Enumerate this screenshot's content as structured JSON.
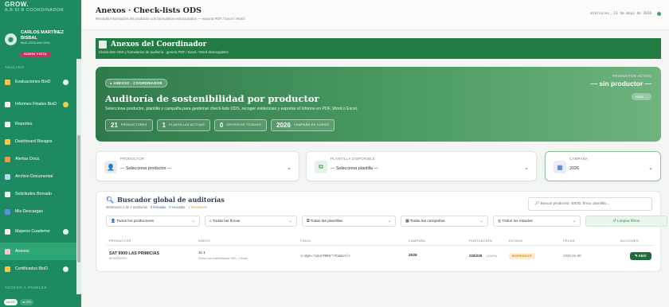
{
  "sidebar": {
    "top_text": "A.B  SI.B  COORDINADOR",
    "logo": "GROW.",
    "user": {
      "avatar": "◉",
      "name": "CARLOS MARTÍNEZ BISBAL",
      "id": "BioD-2025-###-0001",
      "badge": "ADMIN VISTA"
    },
    "section_label": "ANÁLISIS",
    "items": [
      {
        "label": "Evaluaciones BioD",
        "icon": "shield-icon",
        "color": "#f2c94c",
        "dot": "white",
        "tall": true
      },
      {
        "label": "Informes Finales BioD",
        "icon": "document-icon",
        "color": "#f1f1f1",
        "dot": "yellow",
        "tall": true
      },
      {
        "label": "Reportes",
        "icon": "chart-icon",
        "color": "#f1f1f1",
        "dot": "",
        "tall": false
      },
      {
        "label": "Dashboard Riesgos",
        "icon": "warning-icon",
        "color": "#f2c94c",
        "dot": "",
        "tall": false
      },
      {
        "label": "Alertas Docs.",
        "icon": "alert-icon",
        "color": "#f2994a",
        "dot": "",
        "tall": false
      },
      {
        "label": "Archivo Documental",
        "icon": "archive-icon",
        "color": "#b9d7f0",
        "dot": "",
        "tall": false
      },
      {
        "label": "Solicitudes Borrado",
        "icon": "mail-icon",
        "color": "#f1f1f1",
        "dot": "",
        "tall": false
      },
      {
        "label": "Mis Descargas",
        "icon": "download-icon",
        "color": "#5b8def",
        "dot": "",
        "tall": false
      },
      {
        "label": "Mapeos Cuaderno",
        "icon": "map-icon",
        "color": "#f1f1f1",
        "dot": "white",
        "tall": true
      },
      {
        "label": "Anexos",
        "icon": "clip-icon",
        "color": "#f7c6d9",
        "dot": "",
        "tall": false,
        "active": true
      },
      {
        "label": "Certificados BioD",
        "icon": "certificate-icon",
        "color": "#f2c94c",
        "dot": "white",
        "tall": false
      }
    ],
    "section_label_2": "ACCESO A PANELES",
    "lang": [
      "es ES",
      "en EN"
    ]
  },
  "topbar": {
    "title": "Anexos · Check-lists ODS",
    "subtitle": "Recopila información del productor con formularios estructurados — exporta PDF / Excel / Word",
    "date": "miércoles, 13 de mayo de 2026"
  },
  "page_header": {
    "title": "Anexos del Coordinador",
    "subtitle": "Check-lists ODS y formularios de auditoría · genera PDF / Excel / Word descargables"
  },
  "hero": {
    "badge": "● ANEXOS · COORDINADOR",
    "title": "Auditoría de sostenibilidad por productor",
    "description": "Selecciona productor, plantilla y campaña para gestionar check-lists ODS, recoger evidencias y exportar el informe en PDF, Word o Excel.",
    "stats": [
      {
        "num": "21",
        "label": "PRODUCTORES"
      },
      {
        "num": "1",
        "label": "PLANTILLAS ACTIVAS"
      },
      {
        "num": "0",
        "label": "CRITERIOS TOTALES"
      },
      {
        "num": "2026",
        "label": "CAMPAÑA EN CURSO"
      }
    ],
    "right_label": "PRODUCTOR ACTIVO",
    "right_value": "— sin productor —",
    "right_chip": "BIOD —"
  },
  "selectors": {
    "producer": {
      "label": "PRODUCTOR",
      "value": "— Selecciona productor —"
    },
    "template": {
      "label": "PLANTILLA DISPONIBLE",
      "value": "— Selecciona plantilla —"
    },
    "campaign": {
      "label": "CAMPAÑA",
      "value": "2026"
    }
  },
  "search": {
    "title": "Buscador global de auditorías",
    "info_prefix": "Mostrando 1 de 1 auditorías · ",
    "info_firmadas": "0 firmadas",
    "info_sep": " · ",
    "info_enviadas": "0 enviadas",
    "info_borradores": "1 borradores",
    "placeholder": "Buscar productor, BIOD, finca, plantilla…",
    "filters": [
      {
        "label": "👤 Todos los productores",
        "w": 118
      },
      {
        "label": "⌂ Todas las fincas",
        "w": 116
      },
      {
        "label": "⧉ Todas las plantillas",
        "w": 118
      },
      {
        "label": "▦ Todas las campañas",
        "w": 110
      },
      {
        "label": "◎ Todos los estados",
        "w": 110
      }
    ],
    "clear_label": "↺ Limpiar filtros",
    "columns": [
      "PRODUCTOR",
      "ANEXO",
      "FINCA",
      "CAMPAÑA",
      "PUNTUACIÓN",
      "ESTADO",
      "FECHA",
      "ACCIONES"
    ],
    "row": {
      "producer": "SAT 9909 LAS PRIMICIAS",
      "producer_id": "BIOD0000003",
      "annex": "11.1",
      "annex_sub": "Check List Sostenibilidad ODS – Fincas",
      "finca": "</ style=\"color:#999;\">Todas</ i>",
      "campaign": "2026",
      "score": "228/228",
      "score_sub": "(100%)",
      "status": "BORRADOR",
      "date": "2026-04-30",
      "action": "✎ Abrir"
    }
  },
  "colors": {
    "sidebar": "#1e8a62",
    "header": "#237b44",
    "accent": "#2e8f52",
    "draft": "#d08a1e"
  }
}
